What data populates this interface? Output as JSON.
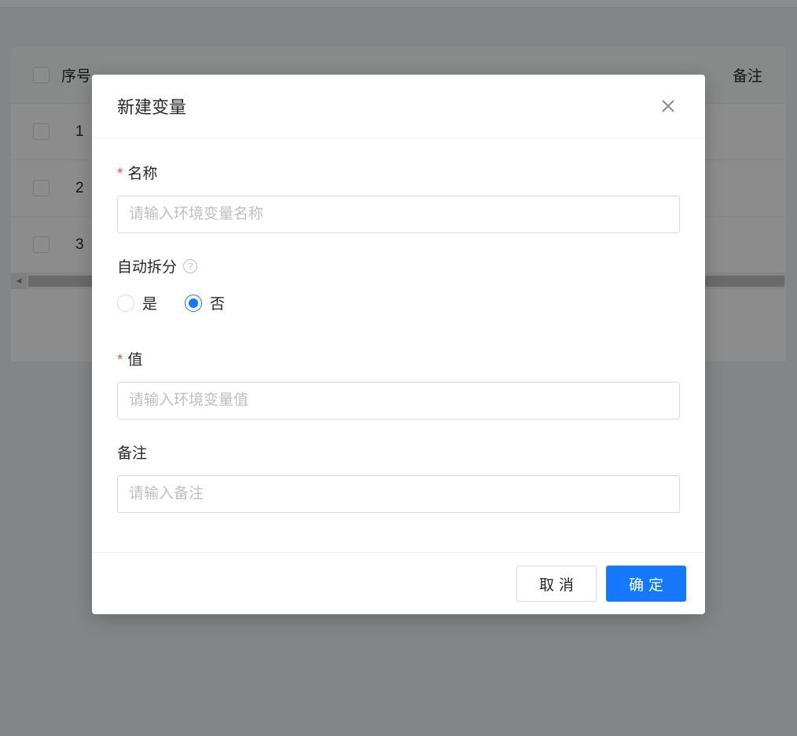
{
  "table": {
    "headers": {
      "seq": "序号",
      "remark": "备注"
    },
    "rows": [
      {
        "seq": "1"
      },
      {
        "seq": "2"
      },
      {
        "seq": "3"
      }
    ]
  },
  "modal": {
    "title": "新建变量",
    "fields": {
      "name": {
        "label": "名称",
        "placeholder": "请输入环境变量名称"
      },
      "autoSplit": {
        "label": "自动拆分",
        "yes": "是",
        "no": "否"
      },
      "value": {
        "label": "值",
        "placeholder": "请输入环境变量值"
      },
      "remark": {
        "label": "备注",
        "placeholder": "请输入备注"
      }
    },
    "buttons": {
      "cancel": "取消",
      "confirm": "确定"
    }
  }
}
